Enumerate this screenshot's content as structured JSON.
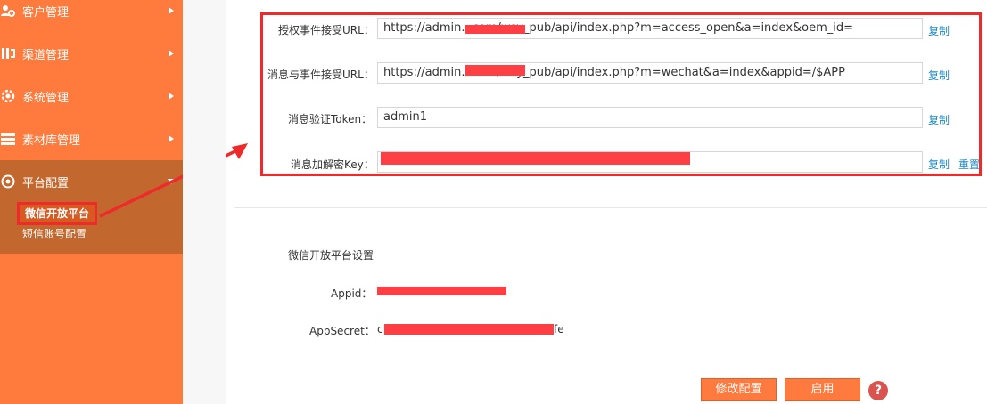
{
  "sidebar": {
    "items": [
      {
        "label": "客户管理",
        "icon": "users-gear-icon"
      },
      {
        "label": "渠道管理",
        "icon": "channel-icon"
      },
      {
        "label": "系统管理",
        "icon": "gear-icon"
      },
      {
        "label": "素材库管理",
        "icon": "stack-icon"
      },
      {
        "label": "平台配置",
        "icon": "settings-cog-icon"
      }
    ],
    "sub_items": [
      {
        "label": "微信开放平台"
      },
      {
        "label": "短信账号配置"
      }
    ]
  },
  "form": {
    "auth_url_label": "授权事件接受URL：",
    "auth_url_value": "https://admin.          .com/wsy_pub/api/index.php?m=access_open&a=index&oem_id=",
    "msg_url_label": "消息与事件接受URL：",
    "msg_url_value": "https://admin.          .com/wsy_pub/api/index.php?m=wechat&a=index&appid=/$APP",
    "token_label": "消息验证Token：",
    "token_value": "admin1",
    "key_label": "消息加解密Key：",
    "key_value": "",
    "copy_label": "复制",
    "reset_label": "重置"
  },
  "settings": {
    "title": "微信开放平台设置",
    "appid_label": "Appid：",
    "appsecret_label": "AppSecret：",
    "appsecret_prefix": "c",
    "appsecret_suffix": "fe"
  },
  "buttons": {
    "modify": "修改配置",
    "enable": "启用",
    "help": "?"
  },
  "colors": {
    "sidebar": "#fe7a3d",
    "sidebar_active": "#c2682e",
    "highlight": "#ee2a2a",
    "link": "#1e88c7",
    "button": "#ff7a3e"
  }
}
